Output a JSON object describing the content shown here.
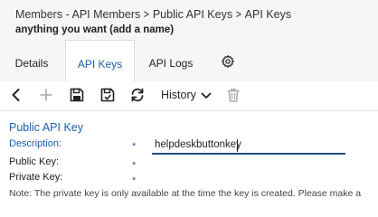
{
  "breadcrumb": {
    "items": [
      "Members - API Members",
      "Public API Keys",
      "API Keys"
    ],
    "separator": ">"
  },
  "record_name": "anything you want (add a name)",
  "tabs": [
    {
      "label": "Details",
      "active": false
    },
    {
      "label": "API Keys",
      "active": true
    },
    {
      "label": "API Logs",
      "active": false
    }
  ],
  "settings_icon": "gear-icon",
  "toolbar": {
    "icons": [
      "back-arrow-icon",
      "add-icon",
      "save-icon",
      "save-close-icon",
      "refresh-icon",
      "trash-icon"
    ],
    "history_label": "History"
  },
  "form": {
    "section_title": "Public API Key",
    "fields": [
      {
        "label": "Description:",
        "required": "*",
        "value": "helpdeskbuttonkey"
      },
      {
        "label": "Public Key:",
        "required": "*"
      },
      {
        "label": "Private Key:",
        "required": "*"
      }
    ],
    "note": "Note: The private key is only available at the time the key is created. Please make a"
  },
  "colors": {
    "accent": "#1f5fa8",
    "header_bg": "#f6f6f6",
    "input_underline": "#1f4f8b"
  }
}
